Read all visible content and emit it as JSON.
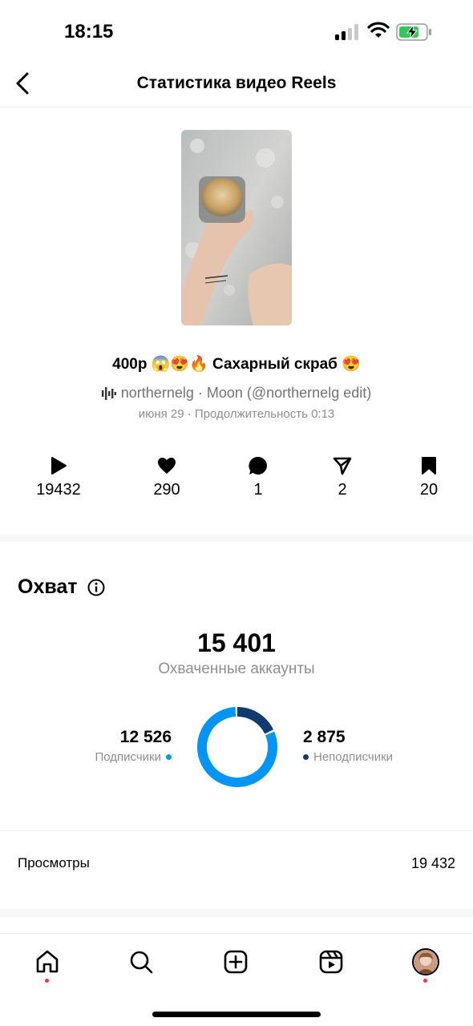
{
  "status_bar": {
    "time": "18:15"
  },
  "header": {
    "title": "Статистика видео Reels"
  },
  "post": {
    "caption": "400р 😱😍🔥 Сахарный скраб 😍",
    "audio": "northernelg · Moon (@northernelg edit)",
    "meta": "июня 29 · Продолжительность 0:13"
  },
  "stats": {
    "plays": "19432",
    "likes": "290",
    "comments": "1",
    "shares": "2",
    "saves": "20"
  },
  "reach": {
    "title": "Охват",
    "total": "15 401",
    "total_label": "Охваченные аккаунты",
    "followers": "12 526",
    "followers_label": "Подписчики",
    "nonfollowers": "2 875",
    "nonfollowers_label": "Неподписчики",
    "followers_fraction": 0.813,
    "followers_color": "#0095f6",
    "nonfollowers_color": "#0f3b6e"
  },
  "views": {
    "label": "Просмотры",
    "value": "19 432"
  },
  "tabbar": {
    "items": [
      "home-icon",
      "search-icon",
      "create-icon",
      "reels-icon",
      "profile-avatar"
    ]
  }
}
